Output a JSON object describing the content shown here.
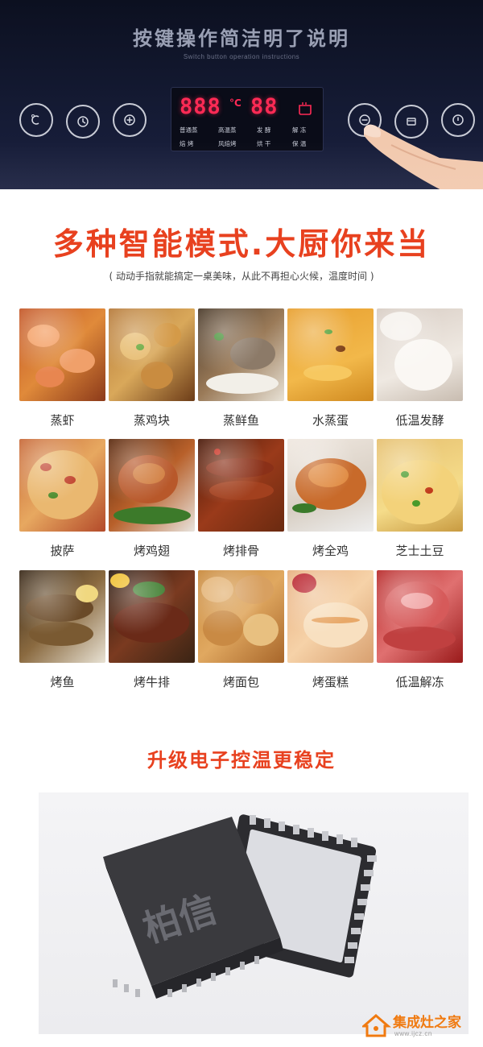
{
  "panel": {
    "title": "按键操作简洁明了说明",
    "subtitle": "Switch button operation instructions",
    "left_buttons": [
      "temperature-icon",
      "clock-icon",
      "plus-icon"
    ],
    "right_buttons": [
      "minus-icon",
      "menu-icon",
      "power-icon"
    ],
    "display": {
      "temp_digits": "888",
      "temp_unit": "°C",
      "time_digits": "88",
      "modes_row1": [
        "普通蒸",
        "高温蒸",
        "发 酵",
        "解 冻"
      ],
      "modes_row2": [
        "焙 烤",
        "风焙烤",
        "烘 干",
        "保 温"
      ]
    }
  },
  "modes": {
    "headline": "多种智能模式.大厨你来当",
    "subline": "( 动动手指就能搞定一桌美味，从此不再担心火候，温度时间 )",
    "items": [
      {
        "label": "蒸虾"
      },
      {
        "label": "蒸鸡块"
      },
      {
        "label": "蒸鲜鱼"
      },
      {
        "label": "水蒸蛋"
      },
      {
        "label": "低温发酵"
      },
      {
        "label": "披萨"
      },
      {
        "label": "烤鸡翅"
      },
      {
        "label": "烤排骨"
      },
      {
        "label": "烤全鸡"
      },
      {
        "label": "芝士土豆"
      },
      {
        "label": "烤鱼"
      },
      {
        "label": "烤牛排"
      },
      {
        "label": "烤面包"
      },
      {
        "label": "烤蛋糕"
      },
      {
        "label": "低温解冻"
      }
    ]
  },
  "chip": {
    "title": "升级电子控温更稳定",
    "chip_text": "柏信"
  },
  "watermark": {
    "name": "集成灶之家",
    "url": "www.ijcz.cn"
  },
  "colors": {
    "accent": "#e8411f",
    "led": "#ff2a55",
    "panel_bg": "#141a33"
  }
}
